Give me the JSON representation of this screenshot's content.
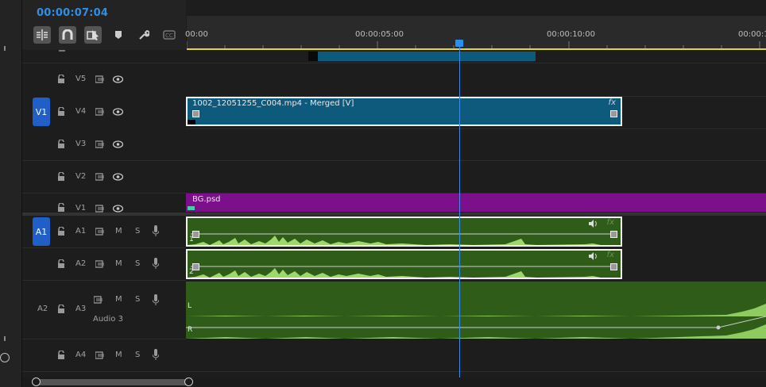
{
  "timecode": "00:00:07:04",
  "ruler": {
    "labels": [
      "00:00",
      "00:00:05:00",
      "00:00:10:00",
      "00:00:1"
    ]
  },
  "tools": [
    "snap-insert-icon",
    "magnet-icon",
    "linked-selection-icon",
    "marker-icon",
    "wrench-icon",
    "captions-icon"
  ],
  "tracks": {
    "video": [
      {
        "id": "V5",
        "source": ""
      },
      {
        "id": "V4",
        "source": "V1"
      },
      {
        "id": "V3",
        "source": ""
      },
      {
        "id": "V2",
        "source": ""
      },
      {
        "id": "V1",
        "source": ""
      }
    ],
    "audio": [
      {
        "id": "A1",
        "source": "A1",
        "m": "M",
        "s": "S",
        "name": ""
      },
      {
        "id": "A2",
        "source": "",
        "m": "M",
        "s": "S",
        "name": ""
      },
      {
        "id": "A3",
        "source": "A2",
        "m": "M",
        "s": "S",
        "name": "Audio 3"
      },
      {
        "id": "A4",
        "source": "",
        "m": "M",
        "s": "S",
        "name": ""
      }
    ]
  },
  "clips": {
    "video_clip": "1002_12051255_C004.mp4 - Merged [V]",
    "bg_clip": "BG.psd",
    "fx": "fx",
    "a1_channel": "1",
    "a2_channel": "2",
    "a3_left": "L",
    "a3_right": "R"
  },
  "colors": {
    "playhead": "#3d8de8",
    "video_clip": "#0e5a7c",
    "audio_clip": "#2f5c19",
    "graphic_clip": "#7c0f8a",
    "timecode": "#2e8fe6",
    "work_area": "#e4d91c"
  }
}
